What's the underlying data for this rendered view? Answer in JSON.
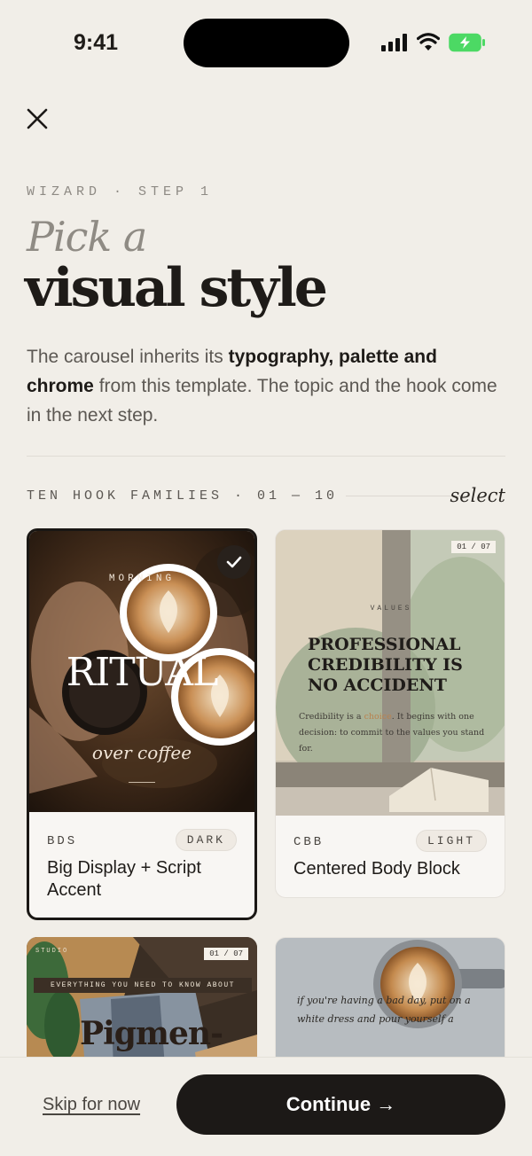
{
  "status": {
    "time": "9:41"
  },
  "header": {
    "eyebrow": "WIZARD · STEP 1",
    "title_italic": "Pick a",
    "title_bold": "visual style",
    "desc_parts": [
      "The carousel inherits its ",
      "typography, palette and chrome",
      " from this template. The topic and the hook come in the next step."
    ]
  },
  "section": {
    "label": "TEN HOOK FAMILIES · 01 — 10",
    "action": "select"
  },
  "cards": [
    {
      "code": "BDS",
      "badge": "DARK",
      "name": "Big Display + Script Accent",
      "preview": {
        "kicker": "MORNING",
        "headline": "RITUAL",
        "script": "over coffee"
      }
    },
    {
      "code": "CBB",
      "badge": "LIGHT",
      "name": "Centered Body Block",
      "preview": {
        "counter": "01 / 07",
        "kicker": "VALUES",
        "headline": "PROFESSIONAL CREDIBILITY IS NO ACCIDENT",
        "body_pre": "Credibility is a ",
        "body_hl": "choice",
        "body_post": ". It begins with one decision: to commit to the values you stand for."
      }
    },
    {
      "preview": {
        "counter": "01 / 07",
        "kicker": "STUDIO",
        "banner": "EVERYTHING YOU NEED TO KNOW ABOUT",
        "headline": "Pigmen-"
      }
    },
    {
      "preview": {
        "quote": "if you're having a bad day, put on a white dress and pour yourself a"
      }
    }
  ],
  "footer": {
    "skip": "Skip for now",
    "continue": "Continue →"
  },
  "colors": {
    "background": "#f1eee8",
    "ink": "#1c1917",
    "muted": "#8f8b84",
    "battery": "#4cd964"
  }
}
